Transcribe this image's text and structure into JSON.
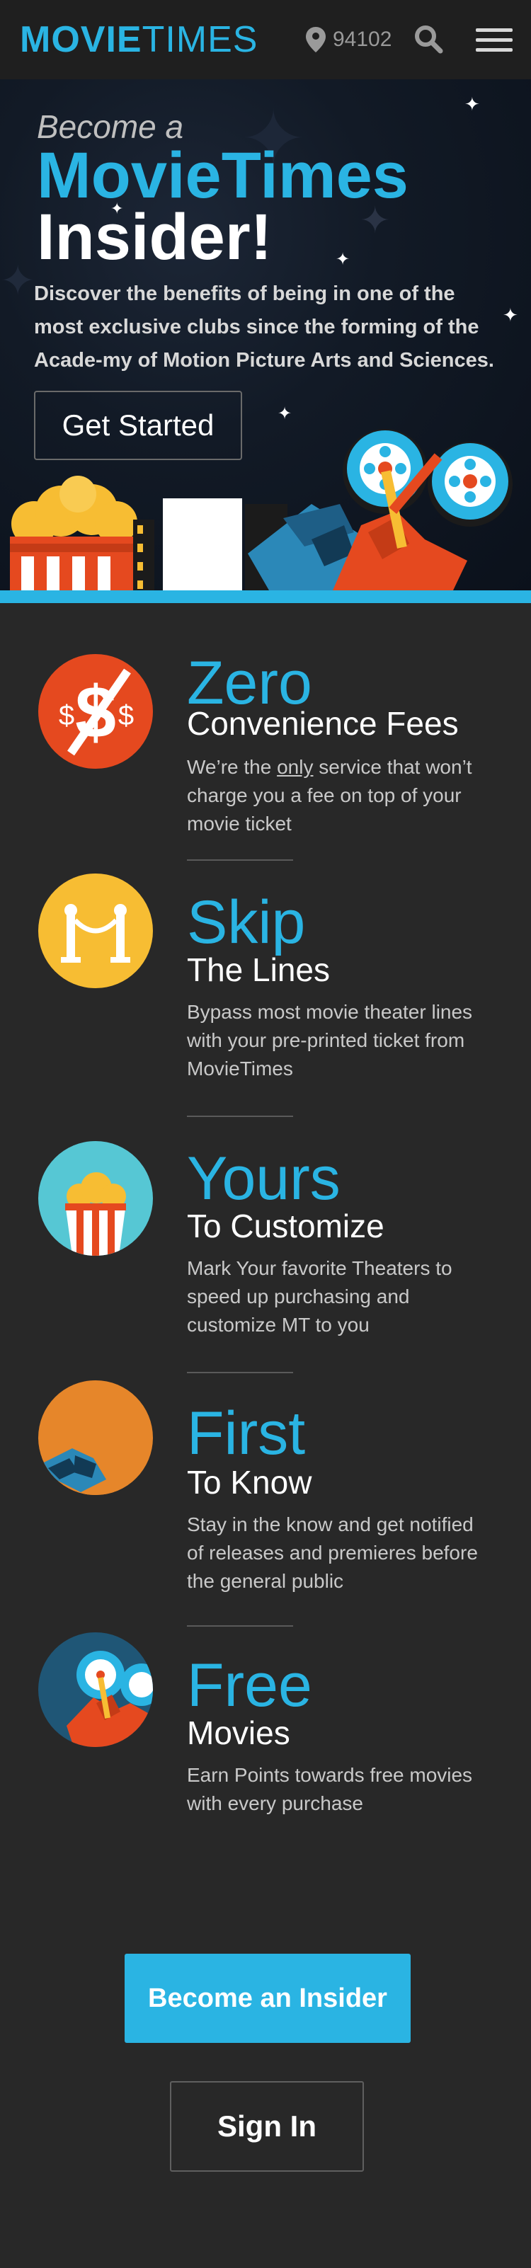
{
  "header": {
    "logo_bold": "MOVIE",
    "logo_thin": "TIMES",
    "location_icon": "map-pin-icon",
    "zip": "94102",
    "search_icon": "search-icon",
    "menu_icon": "hamburger-menu-icon"
  },
  "hero": {
    "kicker": "Become a",
    "brand": "MovieTimes",
    "title": "Insider!",
    "description": "Discover the benefits of being in one of the most exclusive clubs since the forming of the Acade-my of Motion Picture Arts and Sciences.",
    "cta": "Get Started"
  },
  "features": [
    {
      "icon": "no-dollar-icon",
      "big": "Zero",
      "sub": "Convenience Fees",
      "body_pre": "We’re the ",
      "body_u": "only",
      "body_post": " service that won’t charge you a fee on top of your movie ticket"
    },
    {
      "icon": "rope-barrier-icon",
      "big": "Skip",
      "sub": "The Lines",
      "body": "Bypass most movie theater lines with your pre-printed ticket from MovieTimes"
    },
    {
      "icon": "popcorn-icon",
      "big": "Yours",
      "sub": "To Customize",
      "body": "Mark Your favorite Theaters to speed up purchasing and customize MT to you"
    },
    {
      "icon": "3d-glasses-icon",
      "big": "First",
      "sub": "To Know",
      "body": "Stay in the know and get notified of releases and premieres before the general public"
    },
    {
      "icon": "film-projector-icon",
      "big": "Free",
      "sub": "Movies",
      "body": "Earn Points towards free movies with every purchase"
    }
  ],
  "actions": {
    "become_insider": "Become an Insider",
    "sign_in": "Sign In"
  },
  "colors": {
    "accent": "#2ab4e3",
    "background": "#282828",
    "orange": "#e5491f",
    "yellow": "#f7bd33"
  }
}
